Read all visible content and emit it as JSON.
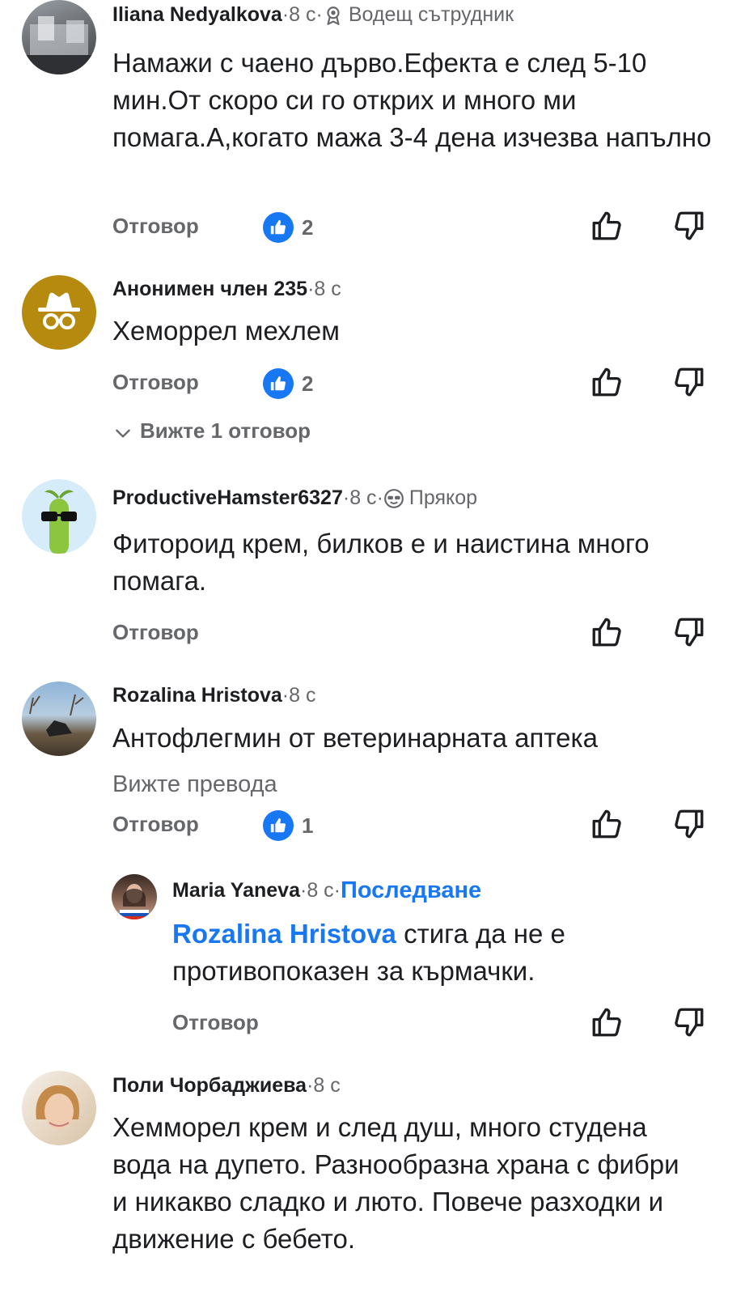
{
  "comments": [
    {
      "author": "Iliana Nedyalkova",
      "time": "8 с",
      "badge": "Водещ сътрудник",
      "badge_icon": "award-icon",
      "text": "Намажи с чаено дърво.Ефекта е след 5-10 мин.От скоро си го открих и много ми помага.А,когато мажа 3-4 дена изчезва напълно",
      "reply_label": "Отговор",
      "likes": "2"
    },
    {
      "author": "Анонимен член 235",
      "time": "8 с",
      "text": "Хеморрел мехлем",
      "reply_label": "Отговор",
      "likes": "2",
      "view_replies": "Вижте 1 отговор"
    },
    {
      "author": "ProductiveHamster6327",
      "time": "8 с",
      "badge": "Прякор",
      "badge_icon": "nickname-icon",
      "text": "Фитороид крем, билков е и наистина много помага.",
      "reply_label": "Отговор"
    },
    {
      "author": "Rozalina Hristova",
      "time": "8 с",
      "text": "Антофлегмин от ветеринарната аптека",
      "translate_label": "Вижте превода",
      "reply_label": "Отговор",
      "likes": "1"
    },
    {
      "author": "Maria Yaneva",
      "time": "8 с",
      "follow_label": "Последване",
      "mention": "Rozalina Hristova",
      "text": " стига да не е противопоказен за кърмачки.",
      "reply_label": "Отговор"
    },
    {
      "author": "Поли Чорбаджиева",
      "time": "8 с",
      "text": "Хемморел крем и след душ, много студена вода на дупето. Разнообразна храна с фибри и никакво сладко и люто. Повече разходки и движение с бебето."
    }
  ],
  "separator": " · ",
  "colors": {
    "accent": "#1877f2",
    "secondary_text": "#65676b",
    "primary_text": "#1c1e21"
  }
}
